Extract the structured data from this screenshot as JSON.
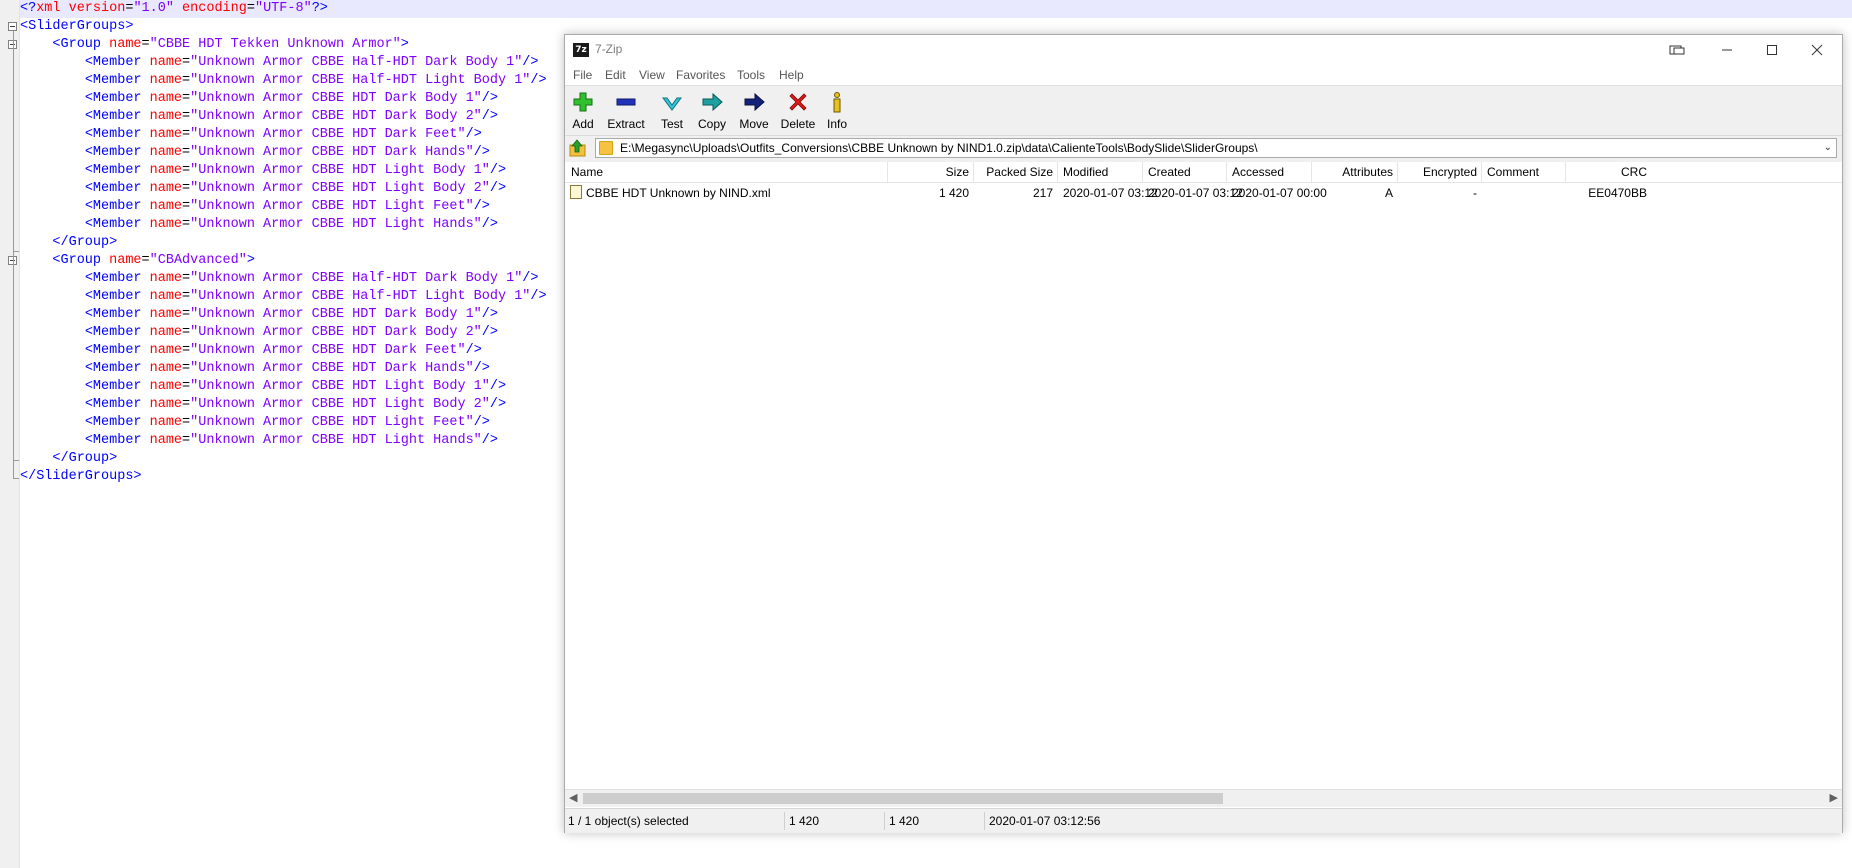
{
  "editor": {
    "lines": [
      [
        [
          "c-tag",
          "<?"
        ],
        [
          "c-attr",
          "xml "
        ],
        [
          "c-attr",
          "version"
        ],
        [
          "c-bl",
          "="
        ],
        [
          "c-val",
          "\"1.0\" "
        ],
        [
          "c-attr",
          "encoding"
        ],
        [
          "c-bl",
          "="
        ],
        [
          "c-val",
          "\"UTF-8\""
        ],
        [
          "c-tag",
          "?>"
        ]
      ],
      [
        [
          "c-tag",
          "<SliderGroups>"
        ]
      ],
      [
        [
          "c-bl",
          "    "
        ],
        [
          "c-tag",
          "<Group "
        ],
        [
          "c-attr",
          "name"
        ],
        [
          "c-bl",
          "="
        ],
        [
          "c-val",
          "\"CBBE HDT Tekken Unknown Armor\""
        ],
        [
          "c-tag",
          ">"
        ]
      ],
      [
        [
          "c-bl",
          "        "
        ],
        [
          "c-tag",
          "<Member "
        ],
        [
          "c-attr",
          "name"
        ],
        [
          "c-bl",
          "="
        ],
        [
          "c-val",
          "\"Unknown Armor CBBE Half-HDT Dark Body 1\""
        ],
        [
          "c-tag",
          "/>"
        ]
      ],
      [
        [
          "c-bl",
          "        "
        ],
        [
          "c-tag",
          "<Member "
        ],
        [
          "c-attr",
          "name"
        ],
        [
          "c-bl",
          "="
        ],
        [
          "c-val",
          "\"Unknown Armor CBBE Half-HDT Light Body 1\""
        ],
        [
          "c-tag",
          "/>"
        ]
      ],
      [
        [
          "c-bl",
          "        "
        ],
        [
          "c-tag",
          "<Member "
        ],
        [
          "c-attr",
          "name"
        ],
        [
          "c-bl",
          "="
        ],
        [
          "c-val",
          "\"Unknown Armor CBBE HDT Dark Body 1\""
        ],
        [
          "c-tag",
          "/>"
        ]
      ],
      [
        [
          "c-bl",
          "        "
        ],
        [
          "c-tag",
          "<Member "
        ],
        [
          "c-attr",
          "name"
        ],
        [
          "c-bl",
          "="
        ],
        [
          "c-val",
          "\"Unknown Armor CBBE HDT Dark Body 2\""
        ],
        [
          "c-tag",
          "/>"
        ]
      ],
      [
        [
          "c-bl",
          "        "
        ],
        [
          "c-tag",
          "<Member "
        ],
        [
          "c-attr",
          "name"
        ],
        [
          "c-bl",
          "="
        ],
        [
          "c-val",
          "\"Unknown Armor CBBE HDT Dark Feet\""
        ],
        [
          "c-tag",
          "/>"
        ]
      ],
      [
        [
          "c-bl",
          "        "
        ],
        [
          "c-tag",
          "<Member "
        ],
        [
          "c-attr",
          "name"
        ],
        [
          "c-bl",
          "="
        ],
        [
          "c-val",
          "\"Unknown Armor CBBE HDT Dark Hands\""
        ],
        [
          "c-tag",
          "/>"
        ]
      ],
      [
        [
          "c-bl",
          "        "
        ],
        [
          "c-tag",
          "<Member "
        ],
        [
          "c-attr",
          "name"
        ],
        [
          "c-bl",
          "="
        ],
        [
          "c-val",
          "\"Unknown Armor CBBE HDT Light Body 1\""
        ],
        [
          "c-tag",
          "/>"
        ]
      ],
      [
        [
          "c-bl",
          "        "
        ],
        [
          "c-tag",
          "<Member "
        ],
        [
          "c-attr",
          "name"
        ],
        [
          "c-bl",
          "="
        ],
        [
          "c-val",
          "\"Unknown Armor CBBE HDT Light Body 2\""
        ],
        [
          "c-tag",
          "/>"
        ]
      ],
      [
        [
          "c-bl",
          "        "
        ],
        [
          "c-tag",
          "<Member "
        ],
        [
          "c-attr",
          "name"
        ],
        [
          "c-bl",
          "="
        ],
        [
          "c-val",
          "\"Unknown Armor CBBE HDT Light Feet\""
        ],
        [
          "c-tag",
          "/>"
        ]
      ],
      [
        [
          "c-bl",
          "        "
        ],
        [
          "c-tag",
          "<Member "
        ],
        [
          "c-attr",
          "name"
        ],
        [
          "c-bl",
          "="
        ],
        [
          "c-val",
          "\"Unknown Armor CBBE HDT Light Hands\""
        ],
        [
          "c-tag",
          "/>"
        ]
      ],
      [
        [
          "c-bl",
          "    "
        ],
        [
          "c-tag",
          "</Group>"
        ]
      ],
      [
        [
          "c-bl",
          "    "
        ],
        [
          "c-tag",
          "<Group "
        ],
        [
          "c-attr",
          "name"
        ],
        [
          "c-bl",
          "="
        ],
        [
          "c-val",
          "\"CBAdvanced\""
        ],
        [
          "c-tag",
          ">"
        ]
      ],
      [
        [
          "c-bl",
          "        "
        ],
        [
          "c-tag",
          "<Member "
        ],
        [
          "c-attr",
          "name"
        ],
        [
          "c-bl",
          "="
        ],
        [
          "c-val",
          "\"Unknown Armor CBBE Half-HDT Dark Body 1\""
        ],
        [
          "c-tag",
          "/>"
        ]
      ],
      [
        [
          "c-bl",
          "        "
        ],
        [
          "c-tag",
          "<Member "
        ],
        [
          "c-attr",
          "name"
        ],
        [
          "c-bl",
          "="
        ],
        [
          "c-val",
          "\"Unknown Armor CBBE Half-HDT Light Body 1\""
        ],
        [
          "c-tag",
          "/>"
        ]
      ],
      [
        [
          "c-bl",
          "        "
        ],
        [
          "c-tag",
          "<Member "
        ],
        [
          "c-attr",
          "name"
        ],
        [
          "c-bl",
          "="
        ],
        [
          "c-val",
          "\"Unknown Armor CBBE HDT Dark Body 1\""
        ],
        [
          "c-tag",
          "/>"
        ]
      ],
      [
        [
          "c-bl",
          "        "
        ],
        [
          "c-tag",
          "<Member "
        ],
        [
          "c-attr",
          "name"
        ],
        [
          "c-bl",
          "="
        ],
        [
          "c-val",
          "\"Unknown Armor CBBE HDT Dark Body 2\""
        ],
        [
          "c-tag",
          "/>"
        ]
      ],
      [
        [
          "c-bl",
          "        "
        ],
        [
          "c-tag",
          "<Member "
        ],
        [
          "c-attr",
          "name"
        ],
        [
          "c-bl",
          "="
        ],
        [
          "c-val",
          "\"Unknown Armor CBBE HDT Dark Feet\""
        ],
        [
          "c-tag",
          "/>"
        ]
      ],
      [
        [
          "c-bl",
          "        "
        ],
        [
          "c-tag",
          "<Member "
        ],
        [
          "c-attr",
          "name"
        ],
        [
          "c-bl",
          "="
        ],
        [
          "c-val",
          "\"Unknown Armor CBBE HDT Dark Hands\""
        ],
        [
          "c-tag",
          "/>"
        ]
      ],
      [
        [
          "c-bl",
          "        "
        ],
        [
          "c-tag",
          "<Member "
        ],
        [
          "c-attr",
          "name"
        ],
        [
          "c-bl",
          "="
        ],
        [
          "c-val",
          "\"Unknown Armor CBBE HDT Light Body 1\""
        ],
        [
          "c-tag",
          "/>"
        ]
      ],
      [
        [
          "c-bl",
          "        "
        ],
        [
          "c-tag",
          "<Member "
        ],
        [
          "c-attr",
          "name"
        ],
        [
          "c-bl",
          "="
        ],
        [
          "c-val",
          "\"Unknown Armor CBBE HDT Light Body 2\""
        ],
        [
          "c-tag",
          "/>"
        ]
      ],
      [
        [
          "c-bl",
          "        "
        ],
        [
          "c-tag",
          "<Member "
        ],
        [
          "c-attr",
          "name"
        ],
        [
          "c-bl",
          "="
        ],
        [
          "c-val",
          "\"Unknown Armor CBBE HDT Light Feet\""
        ],
        [
          "c-tag",
          "/>"
        ]
      ],
      [
        [
          "c-bl",
          "        "
        ],
        [
          "c-tag",
          "<Member "
        ],
        [
          "c-attr",
          "name"
        ],
        [
          "c-bl",
          "="
        ],
        [
          "c-val",
          "\"Unknown Armor CBBE HDT Light Hands\""
        ],
        [
          "c-tag",
          "/>"
        ]
      ],
      [
        [
          "c-bl",
          "    "
        ],
        [
          "c-tag",
          "</Group>"
        ]
      ],
      [
        [
          "c-tag",
          "</SliderGroups>"
        ]
      ]
    ],
    "colors": {
      "tag": "#0000ff",
      "attr": "#ff0000",
      "value": "#8000ff"
    }
  },
  "window": {
    "title": "7-Zip",
    "app_icon_text": "7z",
    "menu": [
      "File",
      "Edit",
      "View",
      "Favorites",
      "Tools",
      "Help"
    ],
    "toolbar": [
      {
        "label": "Add",
        "icon": "plus-icon"
      },
      {
        "label": "Extract",
        "icon": "minus-icon"
      },
      {
        "label": "Test",
        "icon": "check-icon"
      },
      {
        "label": "Copy",
        "icon": "copy-arrow-icon"
      },
      {
        "label": "Move",
        "icon": "move-arrow-icon"
      },
      {
        "label": "Delete",
        "icon": "delete-x-icon"
      },
      {
        "label": "Info",
        "icon": "info-icon"
      }
    ],
    "address": "E:\\Megasync\\Uploads\\Outfits_Conversions\\CBBE Unknown by NIND1.0.zip\\data\\CalienteTools\\BodySlide\\SliderGroups\\",
    "columns": [
      "Name",
      "Size",
      "Packed Size",
      "Modified",
      "Created",
      "Accessed",
      "Attributes",
      "Encrypted",
      "Comment",
      "CRC"
    ],
    "rows": [
      {
        "name": "CBBE HDT Unknown by NIND.xml",
        "size": "1 420",
        "packed": "217",
        "modified": "2020-01-07 03:12",
        "created": "2020-01-07 03:12",
        "accessed": "2020-01-07 00:00",
        "attributes": "A",
        "encrypted": "-",
        "comment": "",
        "crc": "EE0470BB"
      }
    ],
    "status": {
      "selected": "1 / 1 object(s) selected",
      "size": "1 420",
      "packed": "1 420",
      "modified": "2020-01-07 03:12:56"
    }
  }
}
